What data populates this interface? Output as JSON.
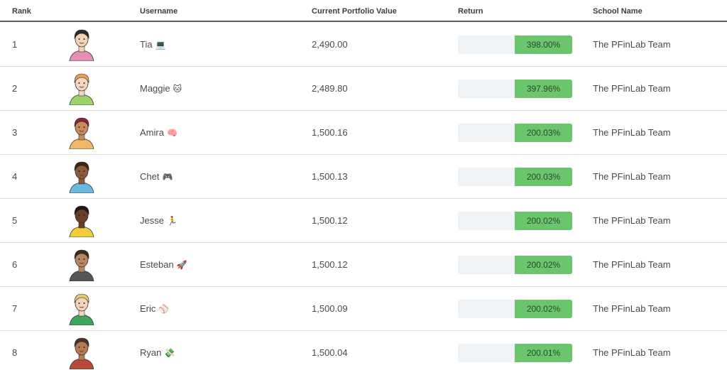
{
  "headers": {
    "rank": "Rank",
    "username": "Username",
    "portfolio_value": "Current Portfolio Value",
    "return": "Return",
    "school": "School Name"
  },
  "rows": [
    {
      "rank": "1",
      "username": "Tia",
      "emoji": "💻",
      "value": "2,490.00",
      "return": "398.00%",
      "school": "The PFinLab Team",
      "avatar": "girl-long-hair-avatar"
    },
    {
      "rank": "2",
      "username": "Maggie",
      "emoji": "🐱",
      "value": "2,489.80",
      "return": "397.96%",
      "school": "The PFinLab Team",
      "avatar": "girl-orange-hair-avatar"
    },
    {
      "rank": "3",
      "username": "Amira",
      "emoji": "🧠",
      "value": "1,500.16",
      "return": "200.03%",
      "school": "The PFinLab Team",
      "avatar": "girl-hijab-avatar"
    },
    {
      "rank": "4",
      "username": "Chet",
      "emoji": "🎮",
      "value": "1,500.13",
      "return": "200.03%",
      "school": "The PFinLab Team",
      "avatar": "boy-blue-shirt-avatar"
    },
    {
      "rank": "5",
      "username": "Jesse",
      "emoji": "🏃",
      "value": "1,500.12",
      "return": "200.02%",
      "school": "The PFinLab Team",
      "avatar": "girl-curly-hair-avatar"
    },
    {
      "rank": "6",
      "username": "Esteban",
      "emoji": "🚀",
      "value": "1,500.12",
      "return": "200.02%",
      "school": "The PFinLab Team",
      "avatar": "boy-thinking-avatar"
    },
    {
      "rank": "7",
      "username": "Eric",
      "emoji": "⚾",
      "value": "1,500.09",
      "return": "200.02%",
      "school": "The PFinLab Team",
      "avatar": "boy-green-shirt-avatar"
    },
    {
      "rank": "8",
      "username": "Ryan",
      "emoji": "💸",
      "value": "1,500.04",
      "return": "200.01%",
      "school": "The PFinLab Team",
      "avatar": "boy-red-shirt-avatar"
    }
  ],
  "colors": {
    "return_fill": "#6ac56d",
    "return_track": "#f0f3f6",
    "header_rule": "#5a5a5a",
    "row_divider": "#dedede"
  },
  "avatar_colors": [
    {
      "hair": "#2b2b2b",
      "skin": "#f3d2b5",
      "shirt": "#e58fb6"
    },
    {
      "hair": "#e9a158",
      "skin": "#f6d6bd",
      "shirt": "#9bd36a"
    },
    {
      "hair": "#8a2436",
      "skin": "#c98a5c",
      "shirt": "#f1b76a"
    },
    {
      "hair": "#3a2618",
      "skin": "#8d5a3b",
      "shirt": "#6cb9de"
    },
    {
      "hair": "#1f1712",
      "skin": "#6a3f26",
      "shirt": "#f3cc3b"
    },
    {
      "hair": "#3b2a20",
      "skin": "#b98560",
      "shirt": "#555555"
    },
    {
      "hair": "#e4c670",
      "skin": "#f4d4b8",
      "shirt": "#3fa45c"
    },
    {
      "hair": "#4a3326",
      "skin": "#b27a55",
      "shirt": "#b84a3a"
    }
  ]
}
